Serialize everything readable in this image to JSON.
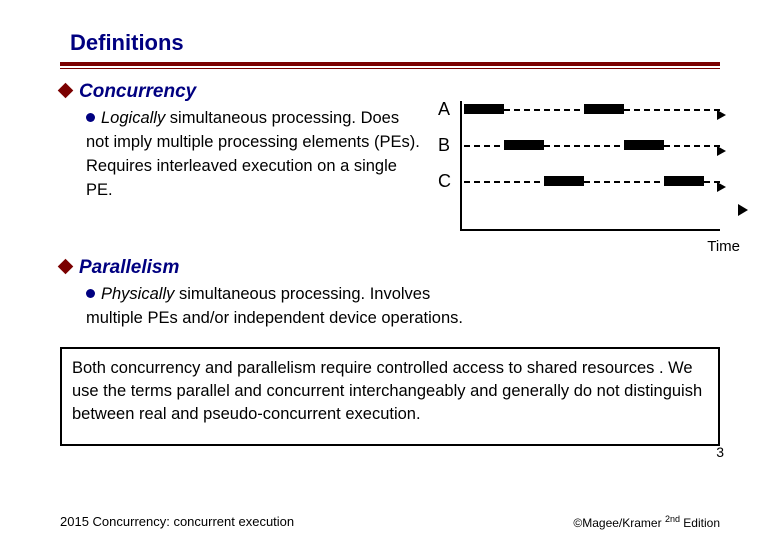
{
  "title": "Definitions",
  "section1": {
    "head": "Concurrency",
    "text_prefix": "Logically",
    "text_rest": " simultaneous processing. Does not imply multiple processing elements (PEs).  Requires interleaved execution on a single PE."
  },
  "section2": {
    "head": "Parallelism",
    "text_prefix": "Physically",
    "text_rest": " simultaneous processing. Involves multiple PEs and/or independent device operations."
  },
  "diagram": {
    "lanes": [
      "A",
      "B",
      "C"
    ],
    "time_label": "Time"
  },
  "note": "Both concurrency and parallelism require controlled access to shared resources . We use the terms parallel and concurrent interchangeably and generally do not distinguish between real and pseudo-concurrent execution.",
  "page_num": "3",
  "footer_left": "2015  Concurrency: concurrent execution",
  "footer_right_prefix": "©Magee/Kramer ",
  "footer_right_sup": "2nd",
  "footer_right_suffix": " Edition"
}
